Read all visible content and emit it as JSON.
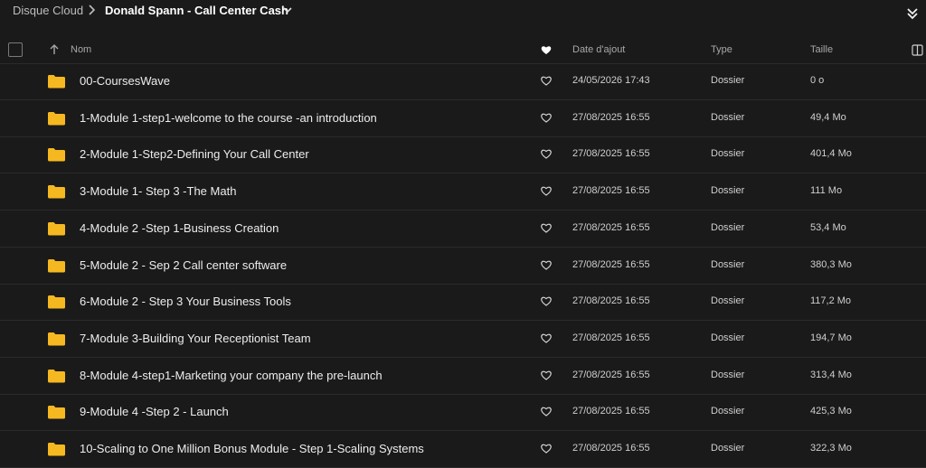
{
  "breadcrumb": {
    "root": "Disque Cloud",
    "current": "Donald Spann - Call Center Cash"
  },
  "columns": {
    "name": "Nom",
    "date": "Date d'ajout",
    "type": "Type",
    "size": "Taille"
  },
  "icons": {
    "folder": "folder-icon",
    "favorite": "heart-outline-icon",
    "accent_folder_color": "#f5b820"
  },
  "rows": [
    {
      "name": "00-CoursesWave",
      "date": "24/05/2026 17:43",
      "type": "Dossier",
      "size": "0 o"
    },
    {
      "name": "1-Module 1-step1-welcome to the course -an introduction",
      "date": "27/08/2025 16:55",
      "type": "Dossier",
      "size": "49,4 Mo"
    },
    {
      "name": "2-Module 1-Step2-Defining Your Call Center",
      "date": "27/08/2025 16:55",
      "type": "Dossier",
      "size": "401,4 Mo"
    },
    {
      "name": "3-Module 1- Step 3 -The Math",
      "date": "27/08/2025 16:55",
      "type": "Dossier",
      "size": "111 Mo"
    },
    {
      "name": "4-Module 2 -Step 1-Business Creation",
      "date": "27/08/2025 16:55",
      "type": "Dossier",
      "size": "53,4 Mo"
    },
    {
      "name": "5-Module 2 - Sep 2 Call center software",
      "date": "27/08/2025 16:55",
      "type": "Dossier",
      "size": "380,3 Mo"
    },
    {
      "name": "6-Module 2 - Step 3 Your Business Tools",
      "date": "27/08/2025 16:55",
      "type": "Dossier",
      "size": "117,2 Mo"
    },
    {
      "name": "7-Module 3-Building Your Receptionist Team",
      "date": "27/08/2025 16:55",
      "type": "Dossier",
      "size": "194,7 Mo"
    },
    {
      "name": "8-Module 4-step1-Marketing your company the pre-launch",
      "date": "27/08/2025 16:55",
      "type": "Dossier",
      "size": "313,4 Mo"
    },
    {
      "name": "9-Module 4 -Step 2 - Launch",
      "date": "27/08/2025 16:55",
      "type": "Dossier",
      "size": "425,3 Mo"
    },
    {
      "name": "10-Scaling to One Million Bonus Module - Step 1-Scaling Systems",
      "date": "27/08/2025 16:55",
      "type": "Dossier",
      "size": "322,3 Mo"
    }
  ]
}
